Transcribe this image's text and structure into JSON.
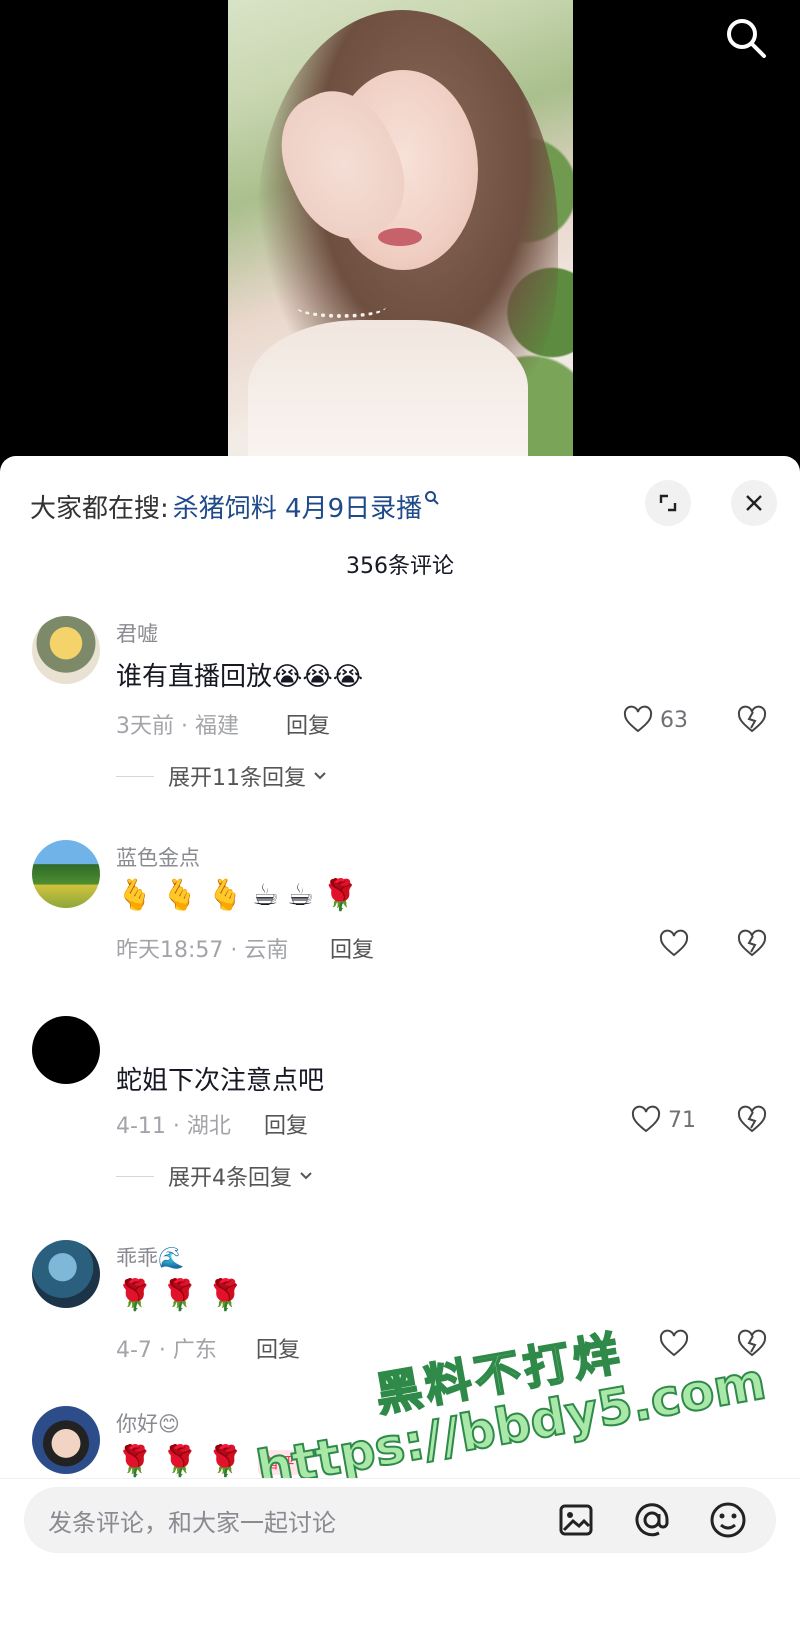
{
  "video": {
    "search_icon": "search-icon"
  },
  "sheet": {
    "hot_search_prefix": "大家都在搜:",
    "hot_search_query": "杀猪饲料 4月9日录播",
    "comment_count": "356条评论",
    "expand_icon": "expand-icon",
    "close_icon": "close-icon"
  },
  "comments": [
    {
      "author": "君嘘",
      "text": "谁有直播回放😭😭😭",
      "meta": "3天前 · 福建",
      "reply_label": "回复",
      "likes": "63",
      "expand_label": "展开11条回复"
    },
    {
      "author": "蓝色金点",
      "text": "🫰🫰🫰☕☕🌹",
      "meta": "昨天18:57 · 云南",
      "reply_label": "回复",
      "likes": ""
    },
    {
      "author": "",
      "text": "蛇姐下次注意点吧",
      "meta": "4-11 · 湖北",
      "reply_label": "回复",
      "likes": "71",
      "expand_label": "展开4条回复"
    },
    {
      "author": "乖乖🌊",
      "text": "🌹🌹🌹",
      "meta": "4-7 · 广东",
      "reply_label": "回复",
      "likes": ""
    },
    {
      "author": "你好😊",
      "text": "🌹🌹🌹",
      "badge": "首评"
    }
  ],
  "watermark": {
    "line1": "黑料不打烊",
    "line2": "https://bbdy5.com"
  },
  "input_bar": {
    "placeholder": "发条评论，和大家一起讨论",
    "image_icon": "image-icon",
    "at_icon": "at-icon",
    "emoji_icon": "emoji-icon"
  },
  "colors": {
    "link_blue": "#1f4a8a",
    "text_primary": "#161823",
    "text_secondary": "#a3a4a9"
  }
}
